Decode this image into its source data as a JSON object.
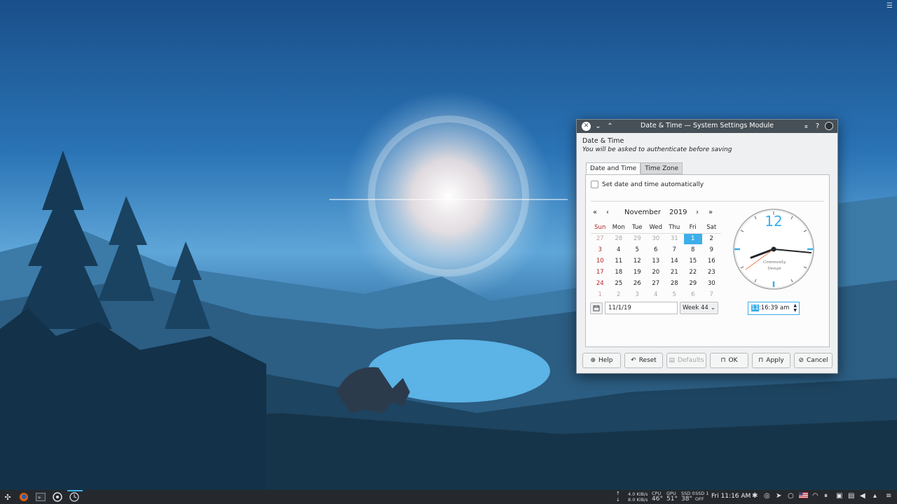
{
  "window": {
    "title": "Date & Time — System Settings Module",
    "header_title": "Date & Time",
    "header_subtitle": "You will be asked to authenticate before saving",
    "tabs": [
      {
        "label": "Date and Time",
        "active": true
      },
      {
        "label": "Time Zone",
        "active": false
      }
    ],
    "auto_checkbox": {
      "label": "Set date and time automatically",
      "checked": false
    }
  },
  "calendar": {
    "month": "November",
    "year": "2019",
    "weekdays": [
      "Sun",
      "Mon",
      "Tue",
      "Wed",
      "Thu",
      "Fri",
      "Sat"
    ],
    "weeks": [
      [
        "27",
        "28",
        "29",
        "30",
        "31",
        "1",
        "2"
      ],
      [
        "3",
        "4",
        "5",
        "6",
        "7",
        "8",
        "9"
      ],
      [
        "10",
        "11",
        "12",
        "13",
        "14",
        "15",
        "16"
      ],
      [
        "17",
        "18",
        "19",
        "20",
        "21",
        "22",
        "23"
      ],
      [
        "24",
        "25",
        "26",
        "27",
        "28",
        "29",
        "30"
      ],
      [
        "1",
        "2",
        "3",
        "4",
        "5",
        "6",
        "7"
      ]
    ],
    "selected_day": "1",
    "date_value": "11/1/19",
    "week_value": "Week 44"
  },
  "clock": {
    "numeral": "12",
    "brand_line1": "Community",
    "brand_line2": "Design",
    "time_value_hour": "11",
    "time_value_rest": ":16:39 am"
  },
  "buttons": {
    "help": "Help",
    "reset": "Reset",
    "defaults": "Defaults",
    "ok": "OK",
    "apply": "Apply",
    "cancel": "Cancel"
  },
  "taskbar": {
    "net_up": "4.0 KiB/s",
    "net_down": "8.0 KiB/s",
    "cpu_label": "CPU",
    "cpu_temp": "46°",
    "gpu_label": "GPU",
    "gpu_temp": "51°",
    "ssd0_label": "SSD 0",
    "ssd0_temp": "38°",
    "ssd1_label": "SSD 1",
    "ssd1_temp": "OFF",
    "clock": "Fri 11:16 AM"
  },
  "colors": {
    "accent": "#3daee9",
    "titlebar": "#475057",
    "taskbar": "#25292d",
    "sunday": "#b32326"
  }
}
